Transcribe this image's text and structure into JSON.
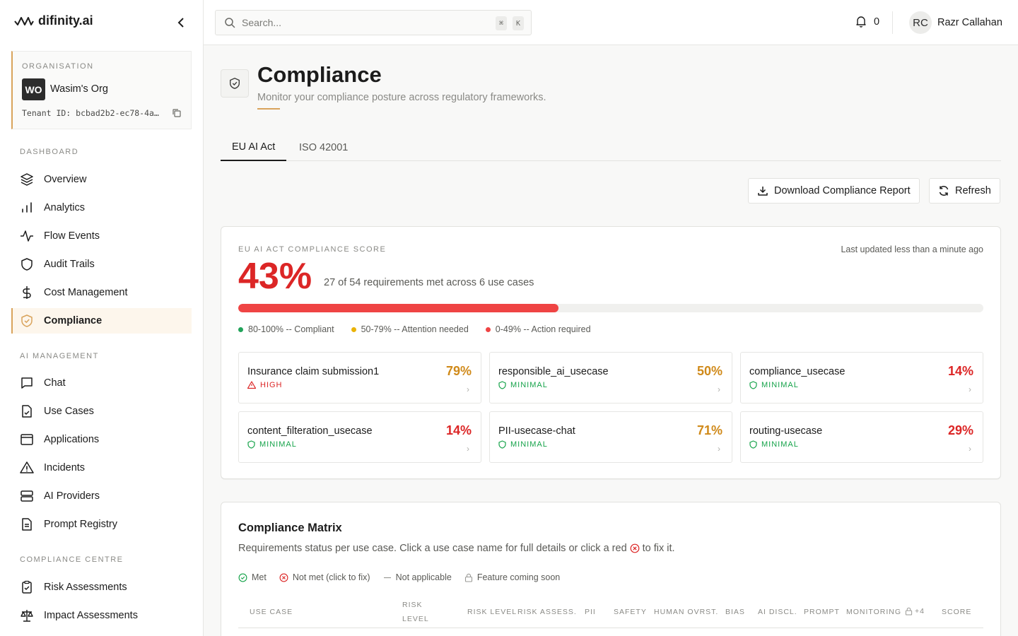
{
  "brand": {
    "name": "difinity.ai"
  },
  "org": {
    "label": "ORGANISATION",
    "initials": "WO",
    "name": "Wasim's Org",
    "tenant": "Tenant ID: bcbad2b2-ec78-4a…"
  },
  "sidebar": {
    "sections": [
      {
        "title": "DASHBOARD"
      },
      {
        "title": "AI MANAGEMENT"
      },
      {
        "title": "COMPLIANCE CENTRE"
      }
    ],
    "items": [
      {
        "label": "Overview",
        "icon": "layers-icon"
      },
      {
        "label": "Analytics",
        "icon": "bar-chart-icon"
      },
      {
        "label": "Flow Events",
        "icon": "activity-icon"
      },
      {
        "label": "Audit Trails",
        "icon": "shield-icon"
      },
      {
        "label": "Cost Management",
        "icon": "dollar-icon"
      },
      {
        "label": "Compliance",
        "icon": "shield-check-icon",
        "active": true
      },
      {
        "label": "Chat",
        "icon": "chat-icon"
      },
      {
        "label": "Use Cases",
        "icon": "file-check-icon"
      },
      {
        "label": "Applications",
        "icon": "window-icon"
      },
      {
        "label": "Incidents",
        "icon": "warning-icon"
      },
      {
        "label": "AI Providers",
        "icon": "server-icon"
      },
      {
        "label": "Prompt Registry",
        "icon": "document-icon"
      },
      {
        "label": "Risk Assessments",
        "icon": "clipboard-check-icon"
      },
      {
        "label": "Impact Assessments",
        "icon": "scale-icon"
      }
    ]
  },
  "topbar": {
    "search_placeholder": "Search...",
    "kbd1": "⌘",
    "kbd2": "K",
    "notifications": "0",
    "user_initials": "RC",
    "user_name": "Razr Callahan"
  },
  "page": {
    "title": "Compliance",
    "subtitle": "Monitor your compliance posture across regulatory frameworks.",
    "tabs": [
      {
        "label": "EU AI Act",
        "active": true
      },
      {
        "label": "ISO 42001"
      }
    ],
    "download_label": "Download Compliance Report",
    "refresh_label": "Refresh"
  },
  "score": {
    "label": "EU AI ACT COMPLIANCE SCORE",
    "last_updated": "Last updated less than a minute ago",
    "value": "43%",
    "fraction": 0.43,
    "description": "27 of 54 requirements met across 6 use cases",
    "legend": [
      {
        "label": "80-100% -- Compliant",
        "color": "#22a35a"
      },
      {
        "label": "50-79% -- Attention needed",
        "color": "#eab308"
      },
      {
        "label": "0-49% -- Action required",
        "color": "#ef4444"
      }
    ],
    "use_cases": [
      {
        "name": "Insurance claim submission1",
        "pct": "79%",
        "risk": "HIGH",
        "pct_color": "#d08a1a",
        "risk_color": "#dc2626"
      },
      {
        "name": "responsible_ai_usecase",
        "pct": "50%",
        "risk": "MINIMAL",
        "pct_color": "#d08a1a",
        "risk_color": "#16a34a"
      },
      {
        "name": "compliance_usecase",
        "pct": "14%",
        "risk": "MINIMAL",
        "pct_color": "#dc2626",
        "risk_color": "#16a34a"
      },
      {
        "name": "content_filteration_usecase",
        "pct": "14%",
        "risk": "MINIMAL",
        "pct_color": "#dc2626",
        "risk_color": "#16a34a"
      },
      {
        "name": "PII-usecase-chat",
        "pct": "71%",
        "risk": "MINIMAL",
        "pct_color": "#d08a1a",
        "risk_color": "#16a34a"
      },
      {
        "name": "routing-usecase",
        "pct": "29%",
        "risk": "MINIMAL",
        "pct_color": "#dc2626",
        "risk_color": "#16a34a"
      }
    ]
  },
  "matrix": {
    "title": "Compliance Matrix",
    "sub_before": "Requirements status per use case. Click a use case name for full details or click a red",
    "sub_after": "to fix it.",
    "legend": [
      "Met",
      "Not met (click to fix)",
      "Not applicable",
      "Feature coming soon"
    ],
    "headers": [
      "USE CASE",
      "RISK",
      "LEVEL",
      "RISK LEVEL",
      "RISK ASSESS.",
      "PII",
      "SAFETY",
      "HUMAN OVRST.",
      "BIAS",
      "AI DISCL.",
      "PROMPT",
      "MONITORING",
      "+4",
      "SCORE"
    ]
  }
}
